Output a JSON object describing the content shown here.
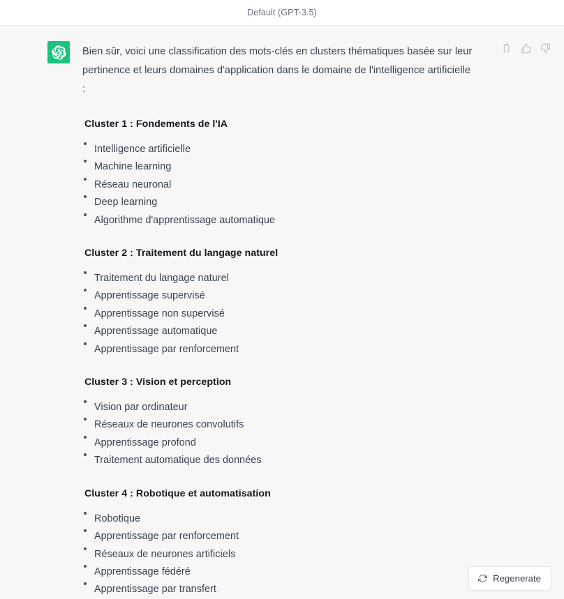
{
  "header": {
    "model_label": "Default (GPT-3.5)"
  },
  "message": {
    "avatar_icon": "openai-logo-icon",
    "avatar_color": "#19c37d",
    "intro": "Bien sûr, voici une classification des mots-clés en clusters thématiques basée sur leur pertinence et leurs domaines d'application dans le domaine de l'intelligence artificielle :",
    "clusters": [
      {
        "heading": "Cluster 1 : Fondements de l'IA",
        "items": [
          "Intelligence artificielle",
          "Machine learning",
          "Réseau neuronal",
          "Deep learning",
          "Algorithme d'apprentissage automatique"
        ]
      },
      {
        "heading": "Cluster 2 : Traitement du langage naturel",
        "items": [
          "Traitement du langage naturel",
          "Apprentissage supervisé",
          "Apprentissage non supervisé",
          "Apprentissage automatique",
          "Apprentissage par renforcement"
        ]
      },
      {
        "heading": "Cluster 3 : Vision et perception",
        "items": [
          "Vision par ordinateur",
          "Réseaux de neurones convolutifs",
          "Apprentissage profond",
          "Traitement automatique des données"
        ]
      },
      {
        "heading": "Cluster 4 : Robotique et automatisation",
        "items": [
          "Robotique",
          "Apprentissage par renforcement",
          "Réseaux de neurones artificiels",
          "Apprentissage fédéré",
          "Apprentissage par transfert"
        ]
      }
    ]
  },
  "actions": {
    "copy_icon": "copy-icon",
    "thumbs_up_icon": "thumbs-up-icon",
    "thumbs_down_icon": "thumbs-down-icon",
    "copy_title": "Copy",
    "thumbs_up_title": "Good response",
    "thumbs_down_title": "Bad response"
  },
  "regenerate": {
    "label": "Regenerate",
    "icon": "refresh-icon"
  },
  "colors": {
    "background": "#f7f7f8",
    "header_background": "#ffffff",
    "accent_green": "#19c37d",
    "body_text": "#374151",
    "heading_text": "#16181d",
    "muted_text": "#6e6e80",
    "icon_grey": "#c5c5d2"
  }
}
